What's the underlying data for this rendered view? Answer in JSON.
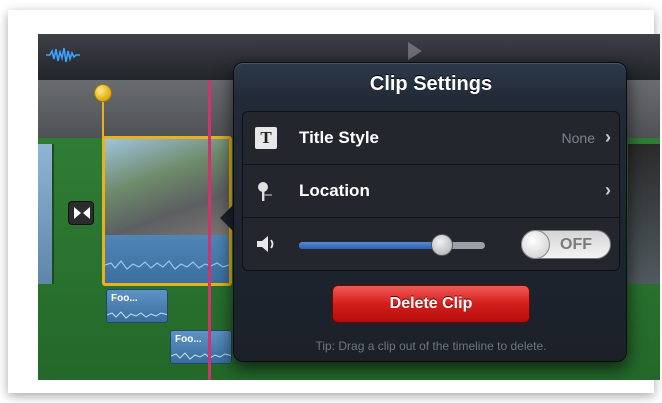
{
  "app": {
    "accent": "#e9b21c",
    "playhead_color": "#d3336c",
    "timeline_color": "#2c7434"
  },
  "toolbar": {
    "audio_icon": "waveform-icon",
    "play_icon": "play-marker-icon"
  },
  "timeline": {
    "sub_clips": [
      {
        "label": "Foo..."
      },
      {
        "label": "Foo..."
      }
    ]
  },
  "clip_settings": {
    "title": "Clip Settings",
    "rows": [
      {
        "icon": "title-style-icon",
        "label": "Title Style",
        "value": "None"
      },
      {
        "icon": "location-pin-icon",
        "label": "Location",
        "value": ""
      }
    ],
    "volume": {
      "icon": "speaker-icon",
      "level": 0.77
    },
    "toggle": {
      "label": "OFF",
      "state": "off"
    },
    "delete_label": "Delete Clip",
    "tip": "Tip: Drag a clip out of the timeline to delete.",
    "delete_color": "#d31e1b"
  }
}
